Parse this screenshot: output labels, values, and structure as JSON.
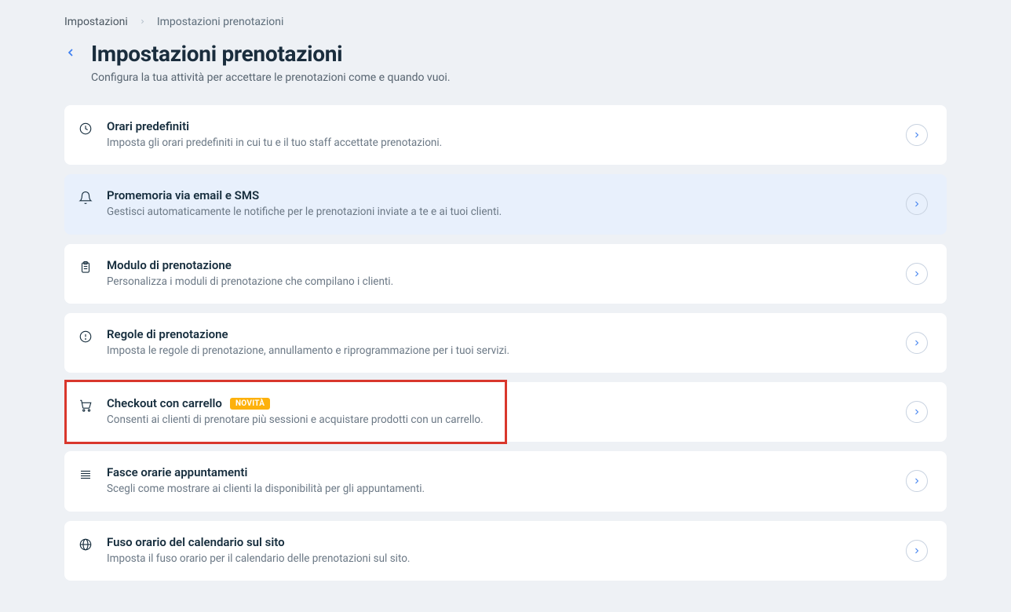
{
  "breadcrumb": {
    "parent": "Impostazioni",
    "current": "Impostazioni prenotazioni"
  },
  "header": {
    "title": "Impostazioni prenotazioni",
    "subtitle": "Configura la tua attività per accettare le prenotazioni come e quando vuoi."
  },
  "cards": [
    {
      "icon": "clock",
      "title": "Orari predefiniti",
      "desc": "Imposta gli orari predefiniti in cui tu e il tuo staff accettate prenotazioni.",
      "highlighted": false,
      "badge": null,
      "redbox": false
    },
    {
      "icon": "bell",
      "title": "Promemoria via email e SMS",
      "desc": "Gestisci automaticamente le notifiche per le prenotazioni inviate a te e ai tuoi clienti.",
      "highlighted": true,
      "badge": null,
      "redbox": false
    },
    {
      "icon": "clipboard",
      "title": "Modulo di prenotazione",
      "desc": "Personalizza i moduli di prenotazione che compilano i clienti.",
      "highlighted": false,
      "badge": null,
      "redbox": false
    },
    {
      "icon": "exclaim",
      "title": "Regole di prenotazione",
      "desc": "Imposta le regole di prenotazione, annullamento e riprogrammazione per i tuoi servizi.",
      "highlighted": false,
      "badge": null,
      "redbox": false
    },
    {
      "icon": "cart",
      "title": "Checkout con carrello",
      "desc": "Consenti ai clienti di prenotare più sessioni e acquistare prodotti con un carrello.",
      "highlighted": false,
      "badge": "NOVITÀ",
      "redbox": true
    },
    {
      "icon": "list",
      "title": "Fasce orarie appuntamenti",
      "desc": "Scegli come mostrare ai clienti la disponibilità per gli appuntamenti.",
      "highlighted": false,
      "badge": null,
      "redbox": false
    },
    {
      "icon": "globe",
      "title": "Fuso orario del calendario sul sito",
      "desc": "Imposta il fuso orario per il calendario delle prenotazioni sul sito.",
      "highlighted": false,
      "badge": null,
      "redbox": false
    }
  ]
}
